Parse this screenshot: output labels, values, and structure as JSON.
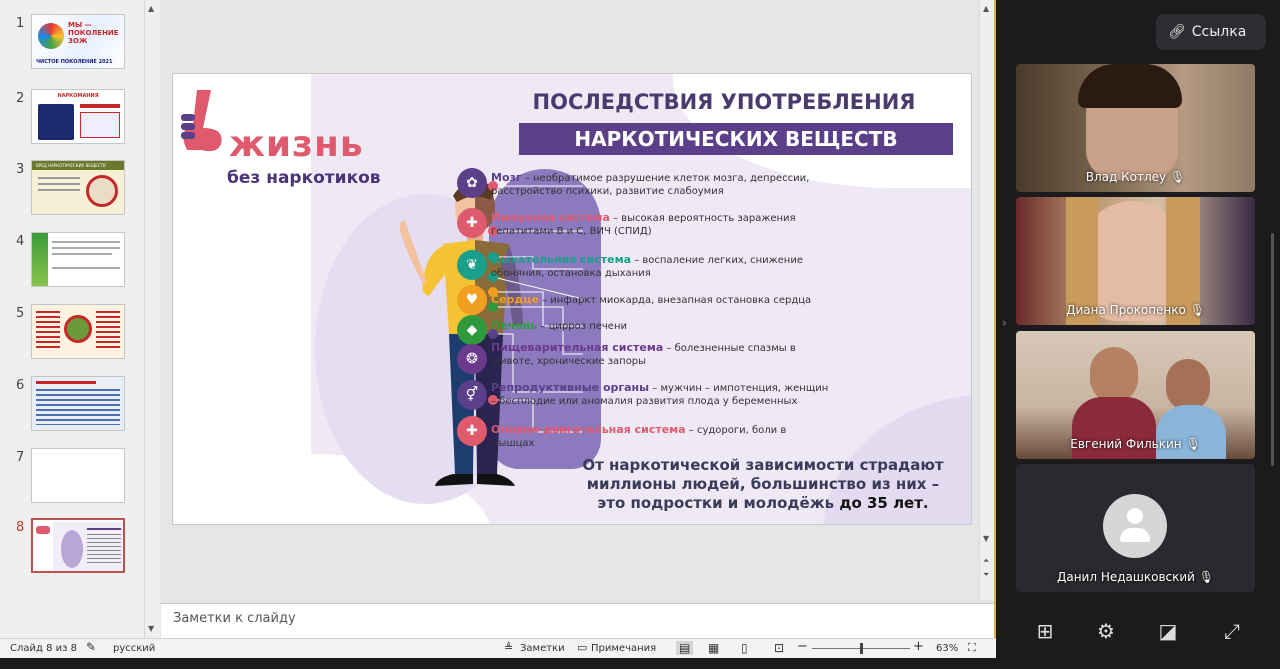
{
  "ppt": {
    "thumbnails": [
      {
        "num": "1",
        "title": "МЫ — ПОКОЛЕНИЕ ЗОЖ",
        "caption": "ЧИСТОЕ ПОКОЛЕНИЕ 2021"
      },
      {
        "num": "2",
        "title": "НАРКОМАНИЯ",
        "caption": ""
      },
      {
        "num": "3",
        "title": "ВРЕД НАРКОТИЧЕСКИХ ВЕЩЕСТВ",
        "caption": ""
      },
      {
        "num": "4",
        "title": "",
        "caption": ""
      },
      {
        "num": "5",
        "title": "",
        "caption": ""
      },
      {
        "num": "6",
        "title": "",
        "caption": ""
      },
      {
        "num": "7",
        "title": "",
        "caption": ""
      },
      {
        "num": "8",
        "title": "",
        "caption": ""
      }
    ],
    "notes_placeholder": "Заметки к слайду",
    "status": {
      "slide_counter": "Слайд 8 из 8",
      "language": "русский",
      "notes": "Заметки",
      "comments": "Примечания",
      "zoom": "63%",
      "zoom_level": 0.5
    }
  },
  "slide": {
    "logo_main": "жизнь",
    "logo_sub": "без наркотиков",
    "title_line1": "ПОСЛЕДСТВИЯ УПОТРЕБЛЕНИЯ",
    "title_line2": "НАРКОТИЧЕСКИХ ВЕЩЕСТВ",
    "items": [
      {
        "name": "Мозг",
        "text": " – необратимое разрушение клеток мозга, депрессии, расстройство психики, развитие слабоумия",
        "color": "#5b3f88",
        "icon": "brain-icon"
      },
      {
        "name": "Иммунная система",
        "text": " – высокая вероятность заражения гепатитами В и С, ВИЧ (СПИД)",
        "color": "#e05a6d",
        "icon": "shield-icon"
      },
      {
        "name": "Дыхательная система",
        "text": " – воспаление легких, снижение обоняния, остановка дыхания",
        "color": "#1aa08a",
        "icon": "lungs-icon"
      },
      {
        "name": "Сердце",
        "text": " – инфаркт миокарда, внезапная остановка сердца",
        "color": "#f0a020",
        "icon": "heart-icon"
      },
      {
        "name": "Печень",
        "text": " – цирроз печени",
        "color": "#2f9a3c",
        "icon": "liver-icon"
      },
      {
        "name": "Пищеварительная система",
        "text": " – болезненные спазмы в животе, хронические запоры",
        "color": "#6a3a8c",
        "icon": "stomach-icon"
      },
      {
        "name": "Репродуктивные органы",
        "text": " – мужчин – импотенция, женщин – бесплодие или аномалия развития плода у беременных",
        "color": "#5b3f88",
        "icon": "gender-icon"
      },
      {
        "name": "Опорно-двигательная система",
        "text": " – судороги, боли в мышцах",
        "color": "#e05a6d",
        "icon": "bone-icon"
      }
    ],
    "footer_line1": "От наркотической зависимости страдают",
    "footer_line2": "миллионы людей, большинство из них –",
    "footer_line3": "это подростки и молодёжь ",
    "footer_bold": "до 35 лет."
  },
  "meet": {
    "link_label": "Ссылка",
    "participants": [
      {
        "name": "Влад Котлеу"
      },
      {
        "name": "Диана Прокопенко"
      },
      {
        "name": "Евгений Филькин"
      },
      {
        "name": "Данил Недашковский"
      }
    ]
  }
}
